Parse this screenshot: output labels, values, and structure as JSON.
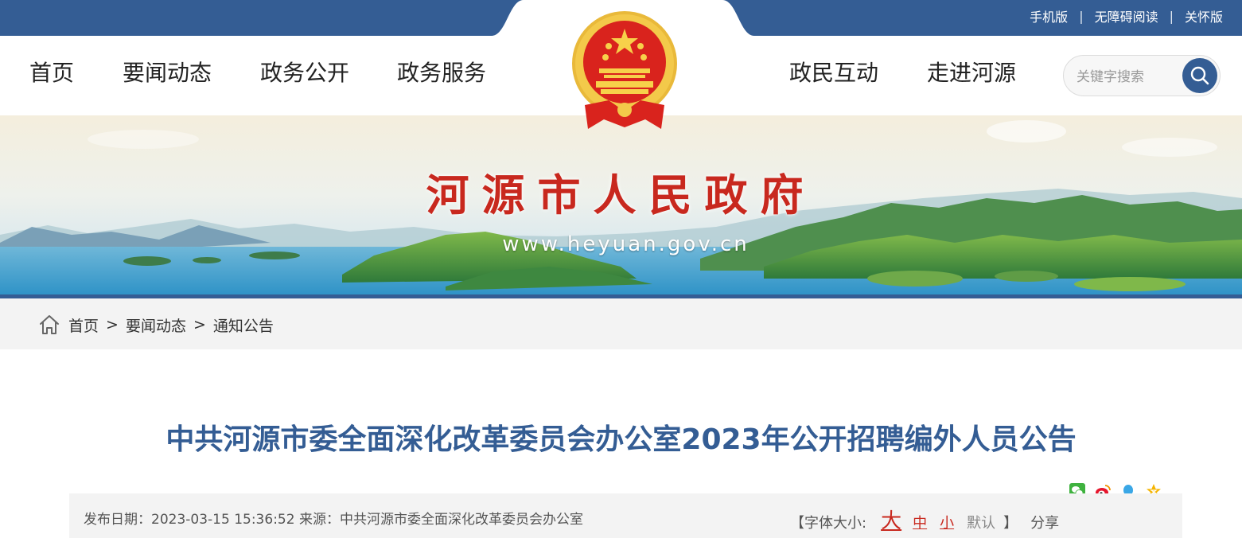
{
  "top_links": [
    "手机版",
    "无障碍阅读",
    "关怀版"
  ],
  "top_separator": "|",
  "nav": {
    "left": [
      "首页",
      "要闻动态",
      "政务公开",
      "政务服务"
    ],
    "right": [
      "政民互动",
      "走进河源"
    ]
  },
  "search": {
    "placeholder": "关键字搜索"
  },
  "banner": {
    "title": "河源市人民政府",
    "url": "www.heyuan.gov.cn"
  },
  "breadcrumb": {
    "items": [
      "首页",
      "要闻动态",
      "通知公告"
    ],
    "separator": ">"
  },
  "article": {
    "title": "中共河源市委全面深化改革委员会办公室2023年公开招聘编外人员公告",
    "meta": "发布日期：2023-03-15 15:36:52 来源：中共河源市委全面深化改革委员会办公室",
    "font_size_label": "【字体大小:",
    "font_sizes": {
      "large": "大",
      "medium": "中",
      "small": "小",
      "default": "默认"
    },
    "font_size_close": "】",
    "share_label": "分享"
  },
  "colors": {
    "brand_blue": "#345d94",
    "red": "#c8281e"
  },
  "icons": [
    "emblem-icon",
    "search-icon",
    "home-icon",
    "wechat-icon",
    "weibo-icon",
    "qq-icon",
    "qzone-icon"
  ]
}
